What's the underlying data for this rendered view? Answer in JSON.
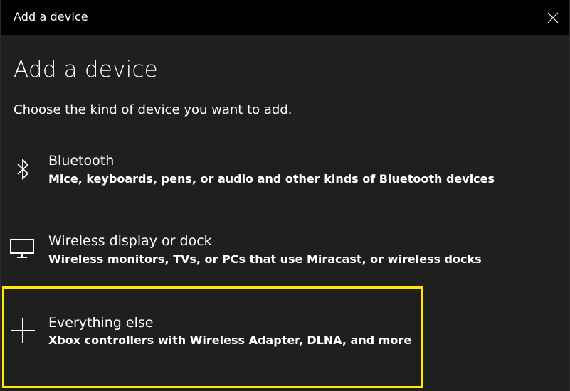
{
  "window": {
    "title": "Add a device"
  },
  "page": {
    "heading": "Add a device",
    "subheading": "Choose the kind of device you want to add."
  },
  "options": [
    {
      "label": "Bluetooth",
      "description": "Mice, keyboards, pens, or audio and other kinds of Bluetooth devices",
      "icon": "bluetooth-icon"
    },
    {
      "label": "Wireless display or dock",
      "description": "Wireless monitors, TVs, or PCs that use Miracast, or wireless docks",
      "icon": "monitor-icon"
    },
    {
      "label": "Everything else",
      "description": "Xbox controllers with Wireless Adapter, DLNA, and more",
      "icon": "plus-icon",
      "highlighted": true
    }
  ],
  "colors": {
    "background": "#1f1f1f",
    "titlebar": "#000000",
    "highlight": "#ffea00",
    "text": "#ffffff"
  }
}
